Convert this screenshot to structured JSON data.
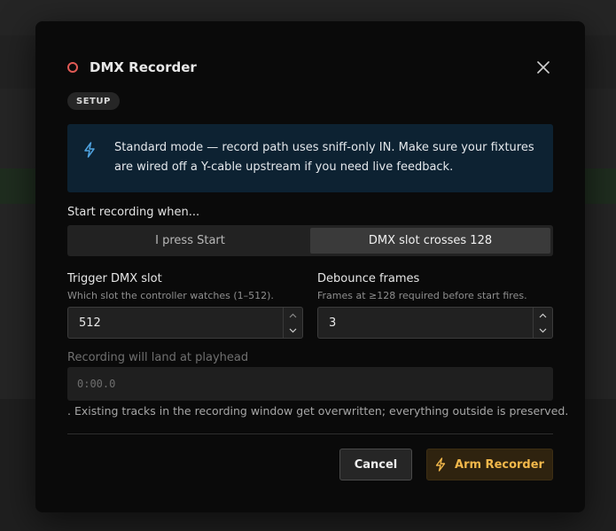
{
  "dialog": {
    "title": "DMX Recorder",
    "badge": "SETUP",
    "info_text": "Standard mode — record path uses sniff-only IN. Make sure your fixtures are wired off a Y-cable upstream if you need live feedback.",
    "start_label": "Start recording when...",
    "start_options": [
      {
        "label": "I press Start",
        "selected": false
      },
      {
        "label": "DMX slot crosses 128",
        "selected": true
      }
    ],
    "trigger": {
      "label": "Trigger DMX slot",
      "help": "Which slot the controller watches (1–512).",
      "value": "512"
    },
    "debounce": {
      "label": "Debounce frames",
      "help": "Frames at ≥128 required before start fires.",
      "value": "3"
    },
    "landing_label": "Recording will land at playhead",
    "landing_value": "0:00.0",
    "overwrite_note": ". Existing tracks in the recording window get overwritten; everything outside is preserved.",
    "cancel_label": "Cancel",
    "arm_label": "Arm Recorder"
  },
  "colors": {
    "record": "#e05a55",
    "info_icon": "#4fa3e0",
    "arm_accent": "#f2b84b"
  },
  "icons": {
    "header": "record-circle-icon",
    "close": "close-icon",
    "info": "lightning-bolt-icon",
    "arm": "lightning-bolt-icon"
  }
}
